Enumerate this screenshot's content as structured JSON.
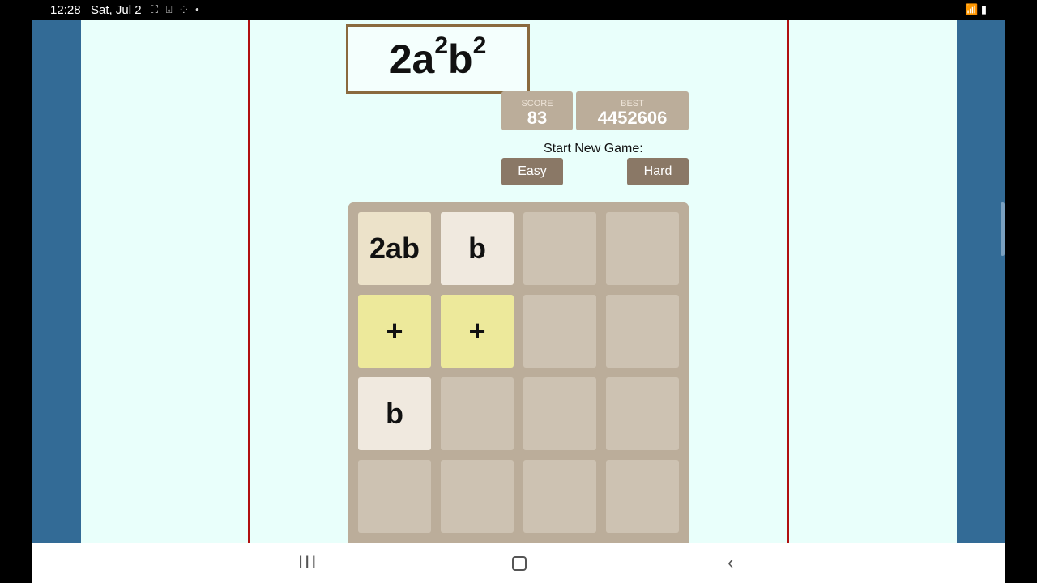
{
  "status": {
    "time": "12:28",
    "date": "Sat, Jul 2",
    "notif_icons": "⛶ ⌻ ⁘ •",
    "sys_icons": "📶 ▮"
  },
  "target": {
    "base": "2a",
    "exp1": "2",
    "mid": "b",
    "exp2": "2"
  },
  "score": {
    "label": "SCORE",
    "value": "83"
  },
  "best": {
    "label": "BEST",
    "value": "4452606"
  },
  "new_game": {
    "label": "Start New Game:",
    "easy": "Easy",
    "hard": "Hard"
  },
  "board": {
    "rows": [
      [
        "2ab",
        "b",
        "",
        ""
      ],
      [
        "+",
        "+",
        "",
        ""
      ],
      [
        "b",
        "",
        "",
        ""
      ],
      [
        "",
        "",
        "",
        ""
      ]
    ]
  },
  "nav": {
    "recent": "III",
    "back": "‹"
  }
}
